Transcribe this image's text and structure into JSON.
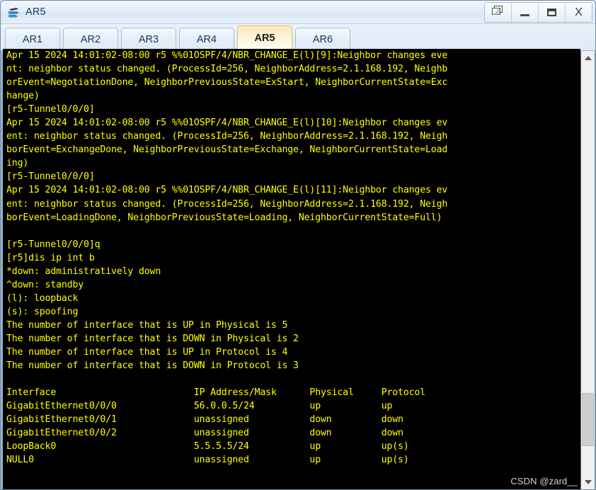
{
  "window": {
    "title": "AR5",
    "app_icon": "router-icon",
    "buttons": [
      {
        "name": "restore-windows-button",
        "icon": "cascade-windows-icon",
        "label": ""
      },
      {
        "name": "minimize-button",
        "icon": "minimize-icon",
        "label": ""
      },
      {
        "name": "maximize-button",
        "icon": "maximize-icon",
        "label": ""
      },
      {
        "name": "close-button",
        "icon": "close-icon",
        "label": "X"
      }
    ]
  },
  "tabs": [
    {
      "label": "AR1",
      "active": false
    },
    {
      "label": "AR2",
      "active": false
    },
    {
      "label": "AR3",
      "active": false
    },
    {
      "label": "AR4",
      "active": false
    },
    {
      "label": "AR5",
      "active": true
    },
    {
      "label": "AR6",
      "active": false
    }
  ],
  "terminal": {
    "foreground_color": "#ffff00",
    "background_color": "#000000",
    "lines": [
      "Apr 15 2024 14:01:02-08:00 r5 %%01OSPF/4/NBR_CHANGE_E(l)[9]:Neighbor changes eve",
      "nt: neighbor status changed. (ProcessId=256, NeighborAddress=2.1.168.192, Neighb",
      "orEvent=NegotiationDone, NeighborPreviousState=ExStart, NeighborCurrentState=Exc",
      "hange)",
      "[r5-Tunnel0/0/0]",
      "Apr 15 2024 14:01:02-08:00 r5 %%01OSPF/4/NBR_CHANGE_E(l)[10]:Neighbor changes ev",
      "ent: neighbor status changed. (ProcessId=256, NeighborAddress=2.1.168.192, Neigh",
      "borEvent=ExchangeDone, NeighborPreviousState=Exchange, NeighborCurrentState=Load",
      "ing)",
      "[r5-Tunnel0/0/0]",
      "Apr 15 2024 14:01:02-08:00 r5 %%01OSPF/4/NBR_CHANGE_E(l)[11]:Neighbor changes ev",
      "ent: neighbor status changed. (ProcessId=256, NeighborAddress=2.1.168.192, Neigh",
      "borEvent=LoadingDone, NeighborPreviousState=Loading, NeighborCurrentState=Full)",
      "",
      "[r5-Tunnel0/0/0]q",
      "[r5]dis ip int b",
      "*down: administratively down",
      "^down: standby",
      "(l): loopback",
      "(s): spoofing",
      "The number of interface that is UP in Physical is 5",
      "The number of interface that is DOWN in Physical is 2",
      "The number of interface that is UP in Protocol is 4",
      "The number of interface that is DOWN in Protocol is 3",
      "",
      "Interface                         IP Address/Mask      Physical     Protocol",
      "GigabitEthernet0/0/0              56.0.0.5/24          up           up",
      "GigabitEthernet0/0/1              unassigned           down         down",
      "GigabitEthernet0/0/2              unassigned           down         down",
      "LoopBack0                         5.5.5.5/24           up           up(s)",
      "NULL0                             unassigned           up           up(s)"
    ],
    "interface_table": {
      "headers": [
        "Interface",
        "IP Address/Mask",
        "Physical",
        "Protocol"
      ],
      "rows": [
        [
          "GigabitEthernet0/0/0",
          "56.0.0.5/24",
          "up",
          "up"
        ],
        [
          "GigabitEthernet0/0/1",
          "unassigned",
          "down",
          "down"
        ],
        [
          "GigabitEthernet0/0/2",
          "unassigned",
          "down",
          "down"
        ],
        [
          "LoopBack0",
          "5.5.5.5/24",
          "up",
          "up(s)"
        ],
        [
          "NULL0",
          "unassigned",
          "up",
          "up(s)"
        ]
      ]
    },
    "counters": {
      "up_physical": 5,
      "down_physical": 2,
      "up_protocol": 4,
      "down_protocol": 3
    },
    "watermark": "CSDN @zard__"
  },
  "scrollbar": {
    "up_arrow": "chevron-up-icon",
    "down_arrow": "chevron-down-icon",
    "thumb_top_percent": 80,
    "thumb_height_percent": 13
  }
}
